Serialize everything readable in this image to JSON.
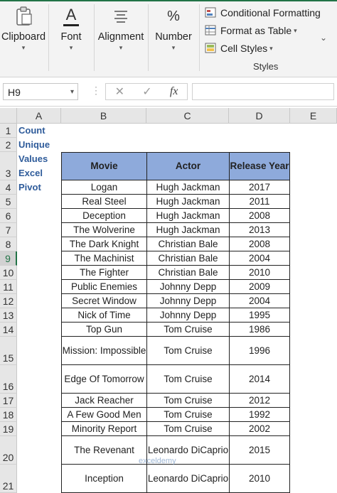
{
  "ribbon": {
    "clipboard": "Clipboard",
    "font": "Font",
    "font_glyph": "A",
    "alignment": "Alignment",
    "number": "Number",
    "number_glyph": "%",
    "conditional_formatting": "Conditional Formatting",
    "format_as_table": "Format as Table",
    "cell_styles": "Cell Styles",
    "styles_group": "Styles"
  },
  "formula_bar": {
    "name_box": "H9",
    "cancel": "✕",
    "enter": "✓",
    "fx": "fx",
    "formula": ""
  },
  "columns": [
    "A",
    "B",
    "C",
    "D",
    "E"
  ],
  "rows": [
    "1",
    "2",
    "3",
    "4",
    "5",
    "6",
    "7",
    "8",
    "9",
    "10",
    "11",
    "12",
    "13",
    "14",
    "15",
    "16",
    "17",
    "18",
    "19",
    "20",
    "21"
  ],
  "sheet": {
    "title": "Count Unique Values Excel Pivot",
    "headers": [
      "Movie",
      "Actor",
      "Release Year"
    ],
    "data": [
      [
        "Logan",
        "Hugh Jackman",
        "2017"
      ],
      [
        "Real Steel",
        "Hugh Jackman",
        "2011"
      ],
      [
        "Deception",
        "Hugh Jackman",
        "2008"
      ],
      [
        "The Wolverine",
        "Hugh Jackman",
        "2013"
      ],
      [
        "The Dark Knight",
        "Christian Bale",
        "2008"
      ],
      [
        "The Machinist",
        "Christian Bale",
        "2004"
      ],
      [
        "The Fighter",
        "Christian Bale",
        "2010"
      ],
      [
        "Public Enemies",
        "Johnny Depp",
        "2009"
      ],
      [
        "Secret Window",
        "Johnny Depp",
        "2004"
      ],
      [
        "Nick of Time",
        "Johnny Depp",
        "1995"
      ],
      [
        "Top Gun",
        "Tom Cruise",
        "1986"
      ],
      [
        "Mission: Impossible",
        "Tom Cruise",
        "1996"
      ],
      [
        "Edge Of Tomorrow",
        "Tom Cruise",
        "2014"
      ],
      [
        "Jack Reacher",
        "Tom Cruise",
        "2012"
      ],
      [
        "A Few Good Men",
        "Tom Cruise",
        "1992"
      ],
      [
        "Minority Report",
        "Tom Cruise",
        "2002"
      ],
      [
        "The Revenant",
        "Leonardo DiCaprio",
        "2015"
      ],
      [
        "Inception",
        "Leonardo DiCaprio",
        "2010"
      ]
    ]
  },
  "watermark": "exceldemy",
  "colors": {
    "header_fill": "#8eaadb",
    "title_text": "#2e5b9a",
    "excel_green": "#217346"
  }
}
